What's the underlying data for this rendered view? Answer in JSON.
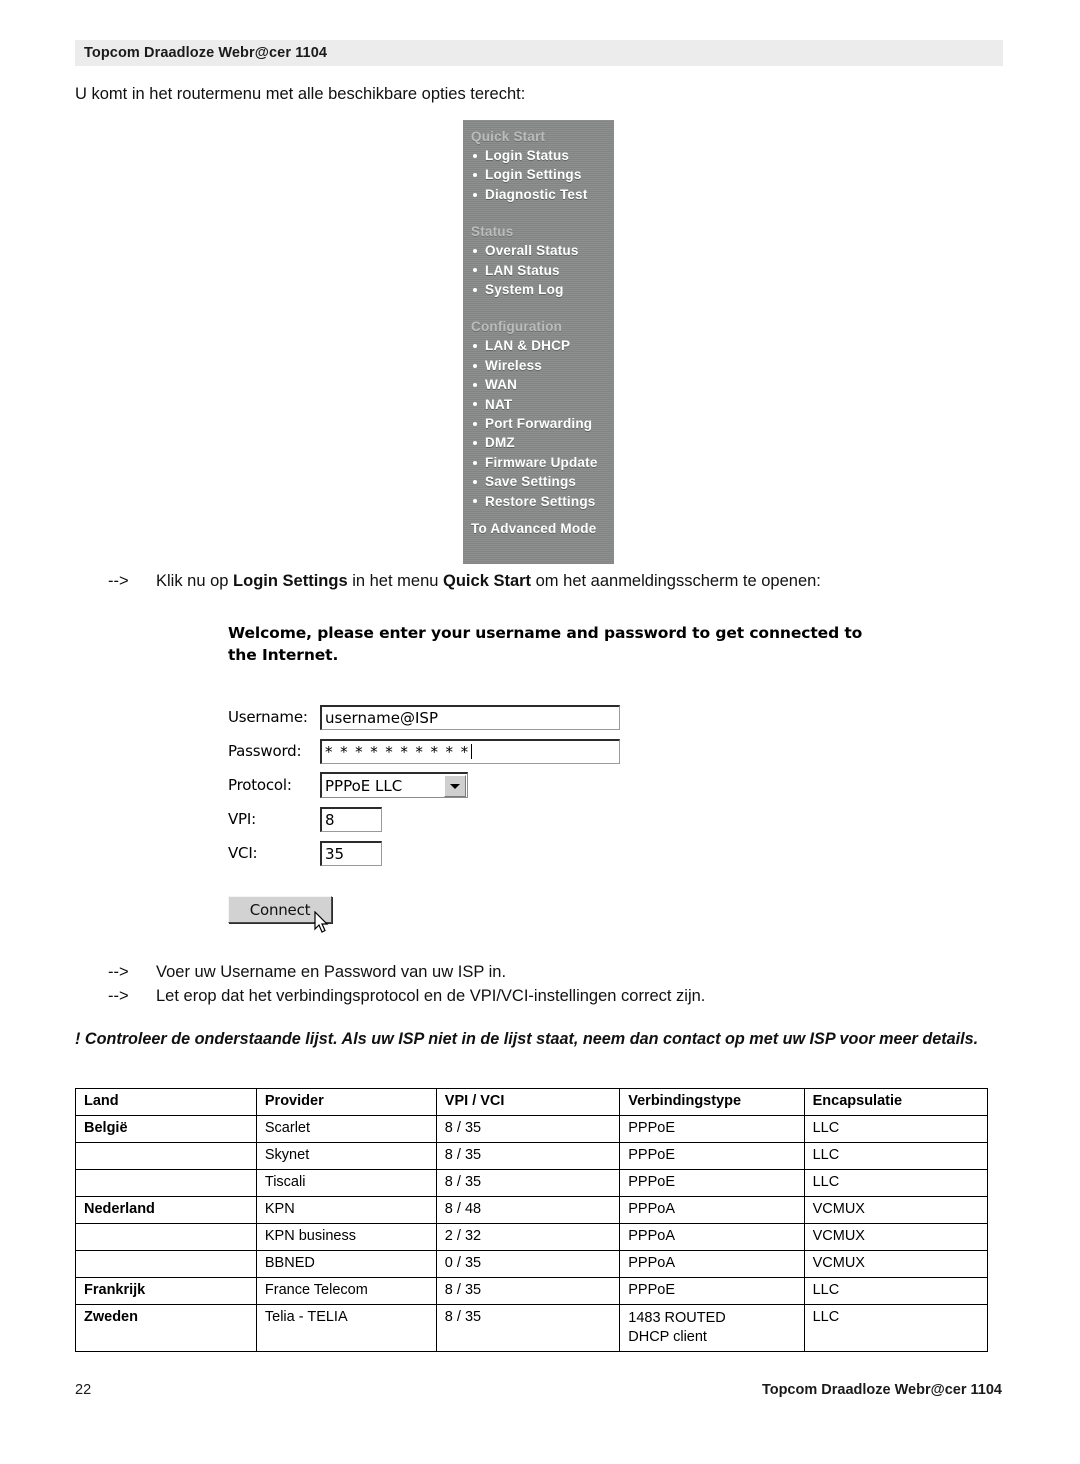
{
  "page": {
    "header_title": "Topcom Draadloze Webr@cer 1104",
    "intro_text": "U komt in het routermenu met alle beschikbare opties terecht:",
    "footer_page_number": "22",
    "footer_title": "Topcom Draadloze Webr@cer 1104"
  },
  "router_menu": {
    "groups": [
      {
        "heading": "Quick Start",
        "items": [
          "Login Status",
          "Login Settings",
          "Diagnostic Test"
        ]
      },
      {
        "heading": "Status",
        "items": [
          "Overall Status",
          "LAN Status",
          "System Log"
        ]
      },
      {
        "heading": "Configuration",
        "items": [
          "LAN & DHCP",
          "Wireless",
          "WAN",
          "NAT",
          "Port Forwarding",
          "DMZ",
          "Firmware Update",
          "Save Settings",
          "Restore Settings"
        ]
      }
    ],
    "advanced_link": "To Advanced Mode"
  },
  "steps": {
    "arrow": "-->",
    "step1_pre": "Klik nu op ",
    "step1_bold1": "Login Settings",
    "step1_mid": " in het menu ",
    "step1_bold2": "Quick Start",
    "step1_post": " om het aanmeldingsscherm te openen:",
    "step2": "Voer uw Username en Password van uw ISP in.",
    "step3": "Let erop dat het verbindingsprotocol en de VPI/VCI-instellingen correct zijn."
  },
  "login_form": {
    "title": "Welcome, please enter your username and password to get connected to the Internet.",
    "fields": [
      {
        "label": "Username:",
        "value": "username@ISP"
      },
      {
        "label": "Password:",
        "value": "* * * * * * * * * *"
      },
      {
        "label": "Protocol:",
        "value": "PPPoE LLC"
      },
      {
        "label": "VPI:",
        "value": "8"
      },
      {
        "label": "VCI:",
        "value": "35"
      }
    ],
    "connect_label": "Connect"
  },
  "note": "! Controleer de onderstaande lijst. Als uw ISP niet in de lijst staat, neem dan contact op met uw ISP voor meer details.",
  "table": {
    "headers": [
      "Land",
      "Provider",
      "VPI / VCI",
      "Verbindingstype",
      "Encapsulatie"
    ],
    "rows": [
      {
        "land": "België",
        "land_bold": true,
        "provider": "Scarlet",
        "vpivci": "8 / 35",
        "type": "PPPoE",
        "encap": "LLC"
      },
      {
        "land": "",
        "land_bold": false,
        "provider": "Skynet",
        "vpivci": "8 / 35",
        "type": "PPPoE",
        "encap": "LLC"
      },
      {
        "land": "",
        "land_bold": false,
        "provider": "Tiscali",
        "vpivci": "8 / 35",
        "type": "PPPoE",
        "encap": "LLC"
      },
      {
        "land": "Nederland",
        "land_bold": true,
        "provider": "KPN",
        "vpivci": "8 / 48",
        "type": "PPPoA",
        "encap": "VCMUX"
      },
      {
        "land": "",
        "land_bold": false,
        "provider": "KPN business",
        "vpivci": "2 / 32",
        "type": "PPPoA",
        "encap": "VCMUX"
      },
      {
        "land": "",
        "land_bold": false,
        "provider": "BBNED",
        "vpivci": "0 / 35",
        "type": "PPPoA",
        "encap": "VCMUX"
      },
      {
        "land": "Frankrijk",
        "land_bold": true,
        "provider": "France Telecom",
        "vpivci": "8 / 35",
        "type": "PPPoE",
        "encap": "LLC"
      },
      {
        "land": "Zweden",
        "land_bold": true,
        "provider": "Telia - TELIA",
        "vpivci": "8 / 35",
        "type": "1483 ROUTED\nDHCP client",
        "encap": "LLC"
      }
    ]
  },
  "colors": {
    "header_band": "#ececec",
    "menu_background": "#888a8a",
    "menu_heading": "#b9bcbc",
    "menu_item": "#ffffff",
    "button_face": "#d2d2d2"
  }
}
